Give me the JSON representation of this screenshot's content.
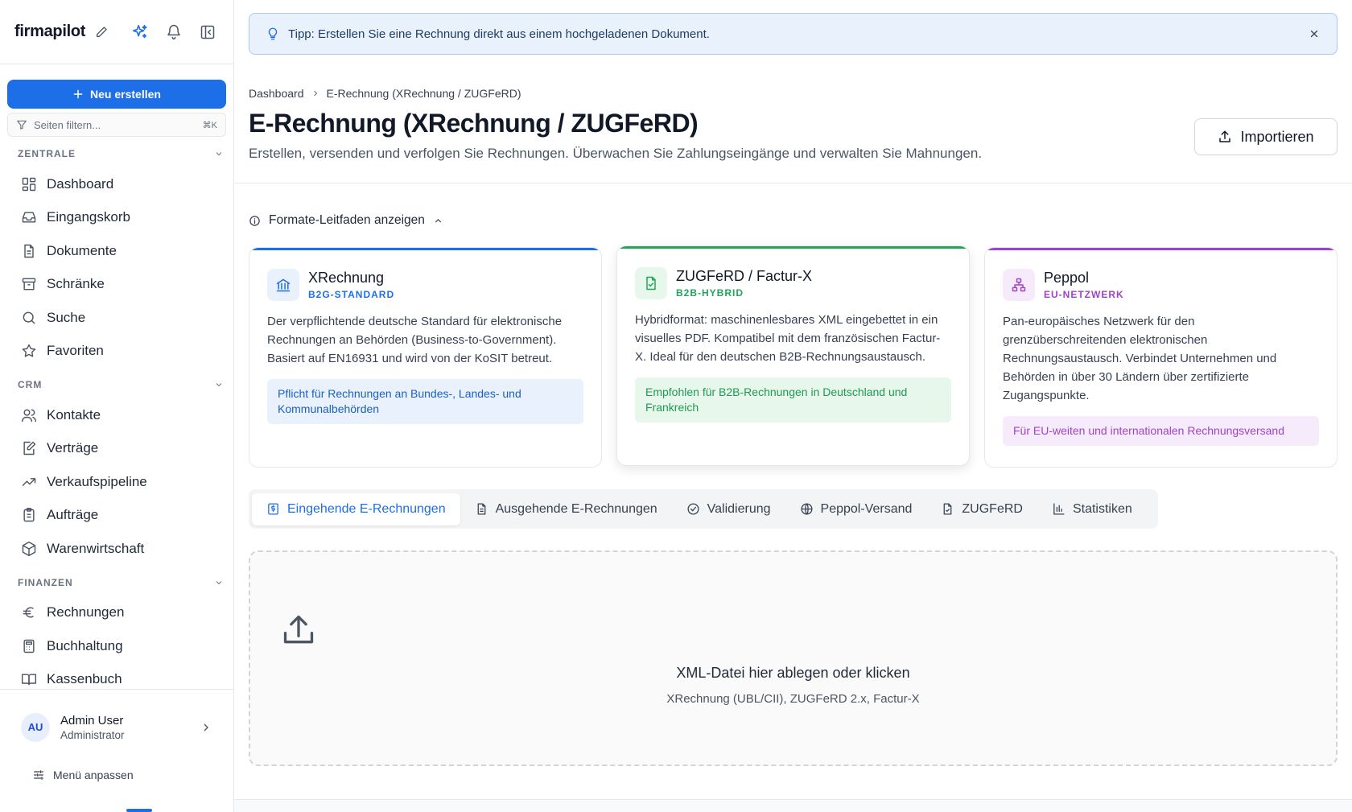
{
  "sidebar": {
    "brand": "firmapilot",
    "new_button": "Neu erstellen",
    "filter_placeholder": "Seiten filtern...",
    "filter_shortcut": "⌘K",
    "sections": [
      {
        "title": "ZENTRALE",
        "items": [
          {
            "label": "Dashboard",
            "icon": "dashboard-icon"
          },
          {
            "label": "Eingangskorb",
            "icon": "inbox-icon"
          },
          {
            "label": "Dokumente",
            "icon": "document-icon"
          },
          {
            "label": "Schränke",
            "icon": "archive-icon"
          },
          {
            "label": "Suche",
            "icon": "search-icon"
          },
          {
            "label": "Favoriten",
            "icon": "star-icon"
          }
        ]
      },
      {
        "title": "CRM",
        "items": [
          {
            "label": "Kontakte",
            "icon": "users-icon"
          },
          {
            "label": "Verträge",
            "icon": "contract-icon"
          },
          {
            "label": "Verkaufspipeline",
            "icon": "trend-icon"
          },
          {
            "label": "Aufträge",
            "icon": "clipboard-icon"
          },
          {
            "label": "Warenwirtschaft",
            "icon": "package-icon"
          }
        ]
      },
      {
        "title": "FINANZEN",
        "items": [
          {
            "label": "Rechnungen",
            "icon": "euro-icon"
          },
          {
            "label": "Buchhaltung",
            "icon": "calculator-icon"
          },
          {
            "label": "Kassenbuch",
            "icon": "book-icon"
          }
        ]
      }
    ],
    "user": {
      "initials": "AU",
      "name": "Admin User",
      "role": "Administrator"
    },
    "menu_customize": "Menü anpassen"
  },
  "tip": {
    "text": "Tipp: Erstellen Sie eine Rechnung direkt aus einem hochgeladenen Dokument."
  },
  "breadcrumb": {
    "root": "Dashboard",
    "current": "E-Rechnung (XRechnung / ZUGFeRD)"
  },
  "page": {
    "title": "E-Rechnung (XRechnung / ZUGFeRD)",
    "subtitle": "Erstellen, versenden und verfolgen Sie Rechnungen. Überwachen Sie Zahlungseingänge und verwalten Sie Mahnungen.",
    "import_label": "Importieren",
    "guide_toggle": "Formate-Leitfaden anzeigen"
  },
  "cards": [
    {
      "title": "XRechnung",
      "tag": "B2G-STANDARD",
      "accent": "#1d6fe8",
      "tint": "#e8f1fc",
      "note_color": "#1d5fc4",
      "desc": "Der verpflichtende deutsche Standard für elektronische Rechnungen an Behörden (Business-to-Government). Basiert auf EN16931 und wird von der KoSIT betreut.",
      "note": "Pflicht für Rechnungen an Bundes-, Landes- und Kommunalbehörden"
    },
    {
      "title": "ZUGFeRD / Factur-X",
      "tag": "B2B-HYBRID",
      "accent": "#22a559",
      "tint": "#e7f7ec",
      "note_color": "#1f9a52",
      "desc": "Hybridformat: maschinenlesbares XML eingebettet in ein visuelles PDF. Kompatibel mit dem französischen Factur-X. Ideal für den deutschen B2B-Rechnungsaustausch.",
      "note": "Empfohlen für B2B-Rechnungen in Deutschland und Frankreich"
    },
    {
      "title": "Peppol",
      "tag": "EU-NETZWERK",
      "accent": "#a142c9",
      "tint": "#f6ebfa",
      "note_color": "#a142c9",
      "desc": "Pan-europäisches Netzwerk für den grenzüberschreitenden elektronischen Rechnungsaustausch. Verbindet Unternehmen und Behörden in über 30 Ländern über zertifizierte Zugangspunkte.",
      "note": "Für EU-weiten und internationalen Rechnungsversand"
    }
  ],
  "tabs": [
    {
      "label": "Eingehende E-Rechnungen",
      "icon": "invoice-in-icon",
      "active": true
    },
    {
      "label": "Ausgehende E-Rechnungen",
      "icon": "file-text-icon",
      "active": false
    },
    {
      "label": "Validierung",
      "icon": "check-circle-icon",
      "active": false
    },
    {
      "label": "Peppol-Versand",
      "icon": "globe-icon",
      "active": false
    },
    {
      "label": "ZUGFeRD",
      "icon": "file-check-icon",
      "active": false
    },
    {
      "label": "Statistiken",
      "icon": "bar-chart-icon",
      "active": false
    }
  ],
  "dropzone": {
    "title": "XML-Datei hier ablegen oder klicken",
    "subtitle": "XRechnung (UBL/CII), ZUGFeRD 2.x, Factur-X"
  }
}
